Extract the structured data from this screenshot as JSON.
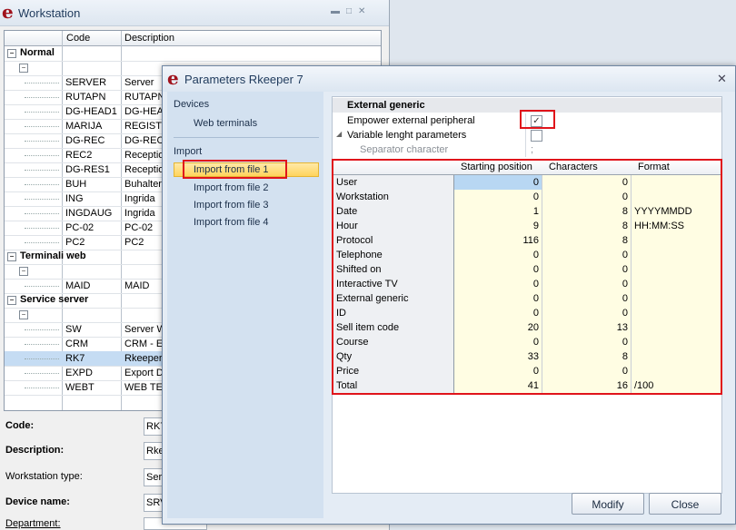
{
  "workstation": {
    "title": "Workstation",
    "columns": [
      "Code",
      "Description"
    ],
    "groups": [
      {
        "label": "Normal",
        "rows": [
          {
            "code": "SERVER",
            "description": "Server"
          },
          {
            "code": "RUTAPN",
            "description": "RUTAPN"
          },
          {
            "code": "DG-HEAD1",
            "description": "DG-HEAD"
          },
          {
            "code": "MARIJA",
            "description": "REGISTR"
          },
          {
            "code": "DG-REC",
            "description": "DG-REC"
          },
          {
            "code": "REC2",
            "description": "Receptio"
          },
          {
            "code": "DG-RES1",
            "description": "Receptio"
          },
          {
            "code": "BUH",
            "description": "Buhalteri"
          },
          {
            "code": "ING",
            "description": "Ingrida"
          },
          {
            "code": "INGDAUG",
            "description": "Ingrida"
          },
          {
            "code": "PC-02",
            "description": "PC-02"
          },
          {
            "code": "PC2",
            "description": "PC2"
          }
        ]
      },
      {
        "label": "Terminali web",
        "rows": [
          {
            "code": "MAID",
            "description": "MAID"
          }
        ]
      },
      {
        "label": "Service server",
        "rows": [
          {
            "code": "SW",
            "description": "Server W"
          },
          {
            "code": "CRM",
            "description": "CRM - Er"
          },
          {
            "code": "RK7",
            "description": "Rkeeper"
          },
          {
            "code": "EXPD",
            "description": "Export D"
          },
          {
            "code": "WEBT",
            "description": "WEB TER"
          }
        ]
      }
    ],
    "form": {
      "code_label": "Code:",
      "code_value": "RK7",
      "description_label": "Description:",
      "description_value": "Rke",
      "type_label": "Workstation type:",
      "type_value": "Ser",
      "device_label": "Device name:",
      "device_value": "SRV",
      "department_label": "Department:"
    }
  },
  "dialog": {
    "title": "Parameters Rkeeper 7",
    "nav": {
      "devices_label": "Devices",
      "web_terminals": "Web terminals",
      "import_label": "Import",
      "items": [
        "Import from file 1",
        "Import from file 2",
        "Import from file 3",
        "Import from file 4"
      ]
    },
    "properties": {
      "category": "External generic",
      "empower_label": "Empower external peripheral",
      "empower_checked": true,
      "variable_label": "Variable lenght parameters",
      "variable_checked": false,
      "separator_label": "Separator character",
      "separator_value": ";"
    },
    "table": {
      "columns": [
        "",
        "Starting position",
        "Characters",
        "Format"
      ],
      "rows": [
        {
          "field": "User",
          "start": "0",
          "chars": "0",
          "format": ""
        },
        {
          "field": "Workstation",
          "start": "0",
          "chars": "0",
          "format": ""
        },
        {
          "field": "Date",
          "start": "1",
          "chars": "8",
          "format": "YYYYMMDD"
        },
        {
          "field": "Hour",
          "start": "9",
          "chars": "8",
          "format": "HH:MM:SS"
        },
        {
          "field": "Protocol",
          "start": "116",
          "chars": "8",
          "format": ""
        },
        {
          "field": "Telephone",
          "start": "0",
          "chars": "0",
          "format": ""
        },
        {
          "field": "Shifted on",
          "start": "0",
          "chars": "0",
          "format": ""
        },
        {
          "field": "Interactive TV",
          "start": "0",
          "chars": "0",
          "format": ""
        },
        {
          "field": "External generic",
          "start": "0",
          "chars": "0",
          "format": ""
        },
        {
          "field": "ID",
          "start": "0",
          "chars": "0",
          "format": ""
        },
        {
          "field": "Sell item code",
          "start": "20",
          "chars": "13",
          "format": ""
        },
        {
          "field": "Course",
          "start": "0",
          "chars": "0",
          "format": ""
        },
        {
          "field": "Qty",
          "start": "33",
          "chars": "8",
          "format": ""
        },
        {
          "field": "Price",
          "start": "0",
          "chars": "0",
          "format": ""
        },
        {
          "field": "Total",
          "start": "41",
          "chars": "16",
          "format": "/100"
        }
      ]
    },
    "buttons": {
      "modify": "Modify",
      "close": "Close"
    }
  }
}
